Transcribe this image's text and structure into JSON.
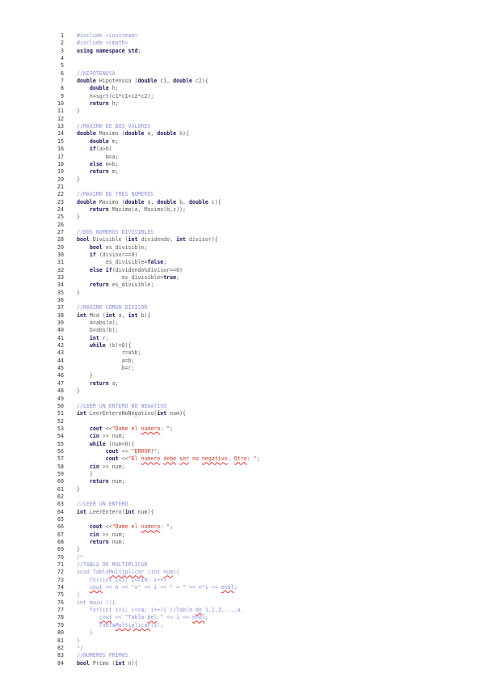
{
  "lines": [
    {
      "n": "1",
      "s": [
        {
          "t": "#include <iostream>",
          "c": "cm"
        }
      ]
    },
    {
      "n": "2",
      "s": [
        {
          "t": "#include <cmath>",
          "c": "cm"
        }
      ]
    },
    {
      "n": "3",
      "s": [
        {
          "t": "using namespace std",
          "c": "kw"
        },
        {
          "t": ";",
          "c": ""
        }
      ]
    },
    {
      "n": "4",
      "s": []
    },
    {
      "n": "5",
      "s": []
    },
    {
      "n": "6",
      "s": [
        {
          "t": "//HIPOTENUSA",
          "c": "cm"
        }
      ]
    },
    {
      "n": "7",
      "s": [
        {
          "t": "double",
          "c": "kw"
        },
        {
          "t": " Hipotenusa (",
          "c": ""
        },
        {
          "t": "double",
          "c": "kw"
        },
        {
          "t": " c1, ",
          "c": ""
        },
        {
          "t": "double",
          "c": "kw"
        },
        {
          "t": " c2){",
          "c": ""
        }
      ]
    },
    {
      "n": "8",
      "s": [
        {
          "t": "    ",
          "c": ""
        },
        {
          "t": "double",
          "c": "kw"
        },
        {
          "t": " h;",
          "c": ""
        }
      ]
    },
    {
      "n": "9",
      "s": [
        {
          "t": "    h=sqrt(c1*c1+c2*c2);",
          "c": ""
        }
      ]
    },
    {
      "n": "10",
      "s": [
        {
          "t": "    ",
          "c": ""
        },
        {
          "t": "return",
          "c": "kw"
        },
        {
          "t": " h;",
          "c": ""
        }
      ]
    },
    {
      "n": "11",
      "s": [
        {
          "t": "}",
          "c": ""
        }
      ]
    },
    {
      "n": "12",
      "s": []
    },
    {
      "n": "13",
      "s": [
        {
          "t": "//MAXIMO DE DOS VALORES",
          "c": "cm"
        }
      ]
    },
    {
      "n": "14",
      "s": [
        {
          "t": "double",
          "c": "kw"
        },
        {
          "t": " Maximo (",
          "c": ""
        },
        {
          "t": "double",
          "c": "kw"
        },
        {
          "t": " a, ",
          "c": ""
        },
        {
          "t": "double",
          "c": "kw"
        },
        {
          "t": " b){",
          "c": ""
        }
      ]
    },
    {
      "n": "15",
      "s": [
        {
          "t": "    ",
          "c": ""
        },
        {
          "t": "double",
          "c": "kw"
        },
        {
          "t": " m;",
          "c": ""
        }
      ]
    },
    {
      "n": "16",
      "s": [
        {
          "t": "    ",
          "c": ""
        },
        {
          "t": "if",
          "c": "kw"
        },
        {
          "t": "(a>b)",
          "c": ""
        }
      ]
    },
    {
      "n": "17",
      "s": [
        {
          "t": "         m=a;",
          "c": ""
        }
      ]
    },
    {
      "n": "18",
      "s": [
        {
          "t": "    ",
          "c": ""
        },
        {
          "t": "else",
          "c": "kw"
        },
        {
          "t": " m=b;",
          "c": ""
        }
      ]
    },
    {
      "n": "19",
      "s": [
        {
          "t": "    ",
          "c": ""
        },
        {
          "t": "return",
          "c": "kw"
        },
        {
          "t": " m;",
          "c": ""
        }
      ]
    },
    {
      "n": "20",
      "s": [
        {
          "t": "}",
          "c": ""
        }
      ]
    },
    {
      "n": "21",
      "s": []
    },
    {
      "n": "22",
      "s": [
        {
          "t": "//MAXIMO DE TRES NUMEROS",
          "c": "cm"
        }
      ]
    },
    {
      "n": "23",
      "s": [
        {
          "t": "double",
          "c": "kw"
        },
        {
          "t": " Maximo (",
          "c": ""
        },
        {
          "t": "double",
          "c": "kw"
        },
        {
          "t": " a, ",
          "c": ""
        },
        {
          "t": "double",
          "c": "kw"
        },
        {
          "t": " b, ",
          "c": ""
        },
        {
          "t": "double",
          "c": "kw"
        },
        {
          "t": " c){",
          "c": ""
        }
      ]
    },
    {
      "n": "24",
      "s": [
        {
          "t": "    ",
          "c": ""
        },
        {
          "t": "return",
          "c": "kw"
        },
        {
          "t": " Maximo(a, Maximo(b,c));",
          "c": ""
        }
      ]
    },
    {
      "n": "25",
      "s": [
        {
          "t": "}",
          "c": ""
        }
      ]
    },
    {
      "n": "26",
      "s": []
    },
    {
      "n": "27",
      "s": [
        {
          "t": "//DOS NUMEROS DIVISIBLES",
          "c": "cm"
        }
      ]
    },
    {
      "n": "28",
      "s": [
        {
          "t": "bool",
          "c": "kw"
        },
        {
          "t": " Divisible (",
          "c": ""
        },
        {
          "t": "int",
          "c": "kw"
        },
        {
          "t": " dividendo, ",
          "c": ""
        },
        {
          "t": "int",
          "c": "kw"
        },
        {
          "t": " divisor){",
          "c": ""
        }
      ]
    },
    {
      "n": "29",
      "s": [
        {
          "t": "    ",
          "c": ""
        },
        {
          "t": "bool",
          "c": "kw"
        },
        {
          "t": " es_divisible;",
          "c": ""
        }
      ]
    },
    {
      "n": "30",
      "s": [
        {
          "t": "    ",
          "c": ""
        },
        {
          "t": "if",
          "c": "kw"
        },
        {
          "t": " (divisor==0)",
          "c": ""
        }
      ]
    },
    {
      "n": "31",
      "s": [
        {
          "t": "         es_divisible=",
          "c": ""
        },
        {
          "t": "false",
          "c": "kw"
        },
        {
          "t": ";",
          "c": ""
        }
      ]
    },
    {
      "n": "32",
      "s": [
        {
          "t": "    ",
          "c": ""
        },
        {
          "t": "else if",
          "c": "kw"
        },
        {
          "t": "(dividendo%divisor==0)",
          "c": ""
        }
      ]
    },
    {
      "n": "33",
      "s": [
        {
          "t": "              es_divisible=",
          "c": ""
        },
        {
          "t": "true",
          "c": "kw"
        },
        {
          "t": ";",
          "c": ""
        }
      ]
    },
    {
      "n": "34",
      "s": [
        {
          "t": "    ",
          "c": ""
        },
        {
          "t": "return",
          "c": "kw"
        },
        {
          "t": " es_divisible;",
          "c": ""
        }
      ]
    },
    {
      "n": "35",
      "s": [
        {
          "t": "}",
          "c": ""
        }
      ]
    },
    {
      "n": "36",
      "s": []
    },
    {
      "n": "37",
      "s": [
        {
          "t": "//MAXIMO COMUN DIVISOR",
          "c": "cm"
        }
      ]
    },
    {
      "n": "38",
      "s": [
        {
          "t": "int",
          "c": "kw"
        },
        {
          "t": " Mcd (",
          "c": ""
        },
        {
          "t": "int",
          "c": "kw"
        },
        {
          "t": " a, ",
          "c": ""
        },
        {
          "t": "int",
          "c": "kw"
        },
        {
          "t": " b){",
          "c": ""
        }
      ]
    },
    {
      "n": "39",
      "s": [
        {
          "t": "    a=abs(a);",
          "c": ""
        }
      ]
    },
    {
      "n": "40",
      "s": [
        {
          "t": "    b=abs(b);",
          "c": ""
        }
      ]
    },
    {
      "n": "41",
      "s": [
        {
          "t": "    ",
          "c": ""
        },
        {
          "t": "int",
          "c": "kw"
        },
        {
          "t": " r;",
          "c": ""
        }
      ]
    },
    {
      "n": "42",
      "s": [
        {
          "t": "    ",
          "c": ""
        },
        {
          "t": "while",
          "c": "kw"
        },
        {
          "t": " (b!=0){",
          "c": ""
        }
      ]
    },
    {
      "n": "43",
      "s": [
        {
          "t": "              r=a%b;",
          "c": ""
        }
      ]
    },
    {
      "n": "44",
      "s": [
        {
          "t": "              a=b;",
          "c": ""
        }
      ]
    },
    {
      "n": "45",
      "s": [
        {
          "t": "              b=r;",
          "c": ""
        }
      ]
    },
    {
      "n": "46",
      "s": [
        {
          "t": "    }",
          "c": ""
        }
      ]
    },
    {
      "n": "47",
      "s": [
        {
          "t": "    ",
          "c": ""
        },
        {
          "t": "return",
          "c": "kw"
        },
        {
          "t": " a;",
          "c": ""
        }
      ]
    },
    {
      "n": "48",
      "s": [
        {
          "t": "}",
          "c": ""
        }
      ]
    },
    {
      "n": "49",
      "s": []
    },
    {
      "n": "50",
      "s": [
        {
          "t": "//LEER UN ENTERO NO NEGATIVO",
          "c": "cm"
        }
      ]
    },
    {
      "n": "51",
      "s": [
        {
          "t": "int",
          "c": "kw"
        },
        {
          "t": " LeerEnteroNoNegativo(",
          "c": ""
        },
        {
          "t": "int",
          "c": "kw"
        },
        {
          "t": " num){",
          "c": ""
        }
      ]
    },
    {
      "n": "52",
      "s": []
    },
    {
      "n": "53",
      "s": [
        {
          "t": "    ",
          "c": ""
        },
        {
          "t": "cout",
          "c": "kw"
        },
        {
          "t": " <<",
          "c": ""
        },
        {
          "t": "\"Dame el ",
          "c": "st"
        },
        {
          "t": "numero",
          "c": "st err"
        },
        {
          "t": ": \"",
          "c": "st"
        },
        {
          "t": ";",
          "c": ""
        }
      ]
    },
    {
      "n": "54",
      "s": [
        {
          "t": "    ",
          "c": ""
        },
        {
          "t": "cin",
          "c": "kw"
        },
        {
          "t": " >> num;",
          "c": ""
        }
      ]
    },
    {
      "n": "55",
      "s": [
        {
          "t": "    ",
          "c": ""
        },
        {
          "t": "while",
          "c": "kw"
        },
        {
          "t": " (num<0){",
          "c": ""
        }
      ]
    },
    {
      "n": "56",
      "s": [
        {
          "t": "         ",
          "c": ""
        },
        {
          "t": "cout",
          "c": "kw"
        },
        {
          "t": " << ",
          "c": ""
        },
        {
          "t": "\"ERROR!\"",
          "c": "st"
        },
        {
          "t": ";",
          "c": ""
        }
      ]
    },
    {
      "n": "57",
      "s": [
        {
          "t": "         ",
          "c": ""
        },
        {
          "t": "cout",
          "c": "kw"
        },
        {
          "t": " <<",
          "c": ""
        },
        {
          "t": "\"El ",
          "c": "st"
        },
        {
          "t": "numero",
          "c": "st err"
        },
        {
          "t": " ",
          "c": "st"
        },
        {
          "t": "debe",
          "c": "st err"
        },
        {
          "t": " ",
          "c": "st"
        },
        {
          "t": "ser",
          "c": "st err"
        },
        {
          "t": " no ",
          "c": "st"
        },
        {
          "t": "negativo",
          "c": "st err"
        },
        {
          "t": ". ",
          "c": "st"
        },
        {
          "t": "Otro",
          "c": "st err"
        },
        {
          "t": ": \"",
          "c": "st"
        },
        {
          "t": ";",
          "c": ""
        }
      ]
    },
    {
      "n": "58",
      "s": [
        {
          "t": "    ",
          "c": ""
        },
        {
          "t": "cin",
          "c": "kw"
        },
        {
          "t": " >> num;",
          "c": ""
        }
      ]
    },
    {
      "n": "59",
      "s": [
        {
          "t": "    }",
          "c": ""
        }
      ]
    },
    {
      "n": "60",
      "s": [
        {
          "t": "    ",
          "c": ""
        },
        {
          "t": "return",
          "c": "kw"
        },
        {
          "t": " num;",
          "c": ""
        }
      ]
    },
    {
      "n": "61",
      "s": [
        {
          "t": "}",
          "c": ""
        }
      ]
    },
    {
      "n": "62",
      "s": []
    },
    {
      "n": "63",
      "s": [
        {
          "t": "//LEER UN ENTERO",
          "c": "cm"
        }
      ]
    },
    {
      "n": "64",
      "s": [
        {
          "t": "int",
          "c": "kw"
        },
        {
          "t": " LeerEntero(",
          "c": ""
        },
        {
          "t": "int",
          "c": "kw"
        },
        {
          "t": " num){",
          "c": ""
        }
      ]
    },
    {
      "n": "65",
      "s": []
    },
    {
      "n": "66",
      "s": [
        {
          "t": "    ",
          "c": ""
        },
        {
          "t": "cout",
          "c": "kw"
        },
        {
          "t": " <<",
          "c": ""
        },
        {
          "t": "\"Dame el ",
          "c": "st"
        },
        {
          "t": "numero",
          "c": "st err"
        },
        {
          "t": ": \"",
          "c": "st"
        },
        {
          "t": ";",
          "c": ""
        }
      ]
    },
    {
      "n": "67",
      "s": [
        {
          "t": "    ",
          "c": ""
        },
        {
          "t": "cin",
          "c": "kw"
        },
        {
          "t": " >> num;",
          "c": ""
        }
      ]
    },
    {
      "n": "68",
      "s": [
        {
          "t": "    ",
          "c": ""
        },
        {
          "t": "return",
          "c": "kw"
        },
        {
          "t": " num;",
          "c": ""
        }
      ]
    },
    {
      "n": "69",
      "s": [
        {
          "t": "}",
          "c": ""
        }
      ]
    },
    {
      "n": "70",
      "s": [
        {
          "t": "/*",
          "c": "cm"
        }
      ]
    },
    {
      "n": "71",
      "s": [
        {
          "t": "//TABLA DE MULTIPLICAR",
          "c": "cm"
        }
      ]
    },
    {
      "n": "72",
      "s": [
        {
          "t": "void Tabla",
          "c": "cm"
        },
        {
          "t": "Multiplicar",
          "c": "cm err"
        },
        {
          "t": " (int ",
          "c": "cm"
        },
        {
          "t": "num",
          "c": "cm err"
        },
        {
          "t": "){",
          "c": "cm"
        }
      ]
    },
    {
      "n": "73",
      "s": [
        {
          "t": "    for(int i=1; i<=10; i++)",
          "c": "cm"
        }
      ]
    },
    {
      "n": "74",
      "s": [
        {
          "t": "    ",
          "c": "cm"
        },
        {
          "t": "cout",
          "c": "cm err"
        },
        {
          "t": " << n << \"x\" << i << \" = \" << n*i << ",
          "c": "cm"
        },
        {
          "t": "endl",
          "c": "cm err"
        },
        {
          "t": ";",
          "c": "cm"
        }
      ]
    },
    {
      "n": "75",
      "s": [
        {
          "t": "}",
          "c": "cm"
        }
      ]
    },
    {
      "n": "76",
      "s": [
        {
          "t": "int main (){",
          "c": "cm"
        }
      ]
    },
    {
      "n": "77",
      "s": [
        {
          "t": "    for(int i=1; i<=a; i++){ //Tabla ",
          "c": "cm"
        },
        {
          "t": "de",
          "c": "cm err"
        },
        {
          "t": " 1,2,3,...,a.",
          "c": "cm"
        }
      ]
    },
    {
      "n": "78",
      "s": [
        {
          "t": "       ",
          "c": "cm"
        },
        {
          "t": "cout",
          "c": "cm err"
        },
        {
          "t": " << \"Tabla ",
          "c": "cm"
        },
        {
          "t": "del",
          "c": "cm err"
        },
        {
          "t": " \" << i << ",
          "c": "cm"
        },
        {
          "t": "endl",
          "c": "cm err"
        },
        {
          "t": ";",
          "c": "cm"
        }
      ]
    },
    {
      "n": "79",
      "s": [
        {
          "t": "       Tabla",
          "c": "cm"
        },
        {
          "t": "Multiplicar",
          "c": "cm err"
        },
        {
          "t": "(i);",
          "c": "cm"
        }
      ]
    },
    {
      "n": "80",
      "s": [
        {
          "t": "    }",
          "c": "cm"
        }
      ]
    },
    {
      "n": "81",
      "s": [
        {
          "t": "}",
          "c": "cm"
        }
      ]
    },
    {
      "n": "82",
      "s": [
        {
          "t": "*/",
          "c": "cm"
        }
      ]
    },
    {
      "n": "83",
      "s": [
        {
          "t": "//NUMEROS PRIMOS",
          "c": "cm"
        }
      ]
    },
    {
      "n": "84",
      "s": [
        {
          "t": "bool",
          "c": "kw"
        },
        {
          "t": " Primo (",
          "c": ""
        },
        {
          "t": "int",
          "c": "kw"
        },
        {
          "t": " n){",
          "c": ""
        }
      ]
    }
  ]
}
